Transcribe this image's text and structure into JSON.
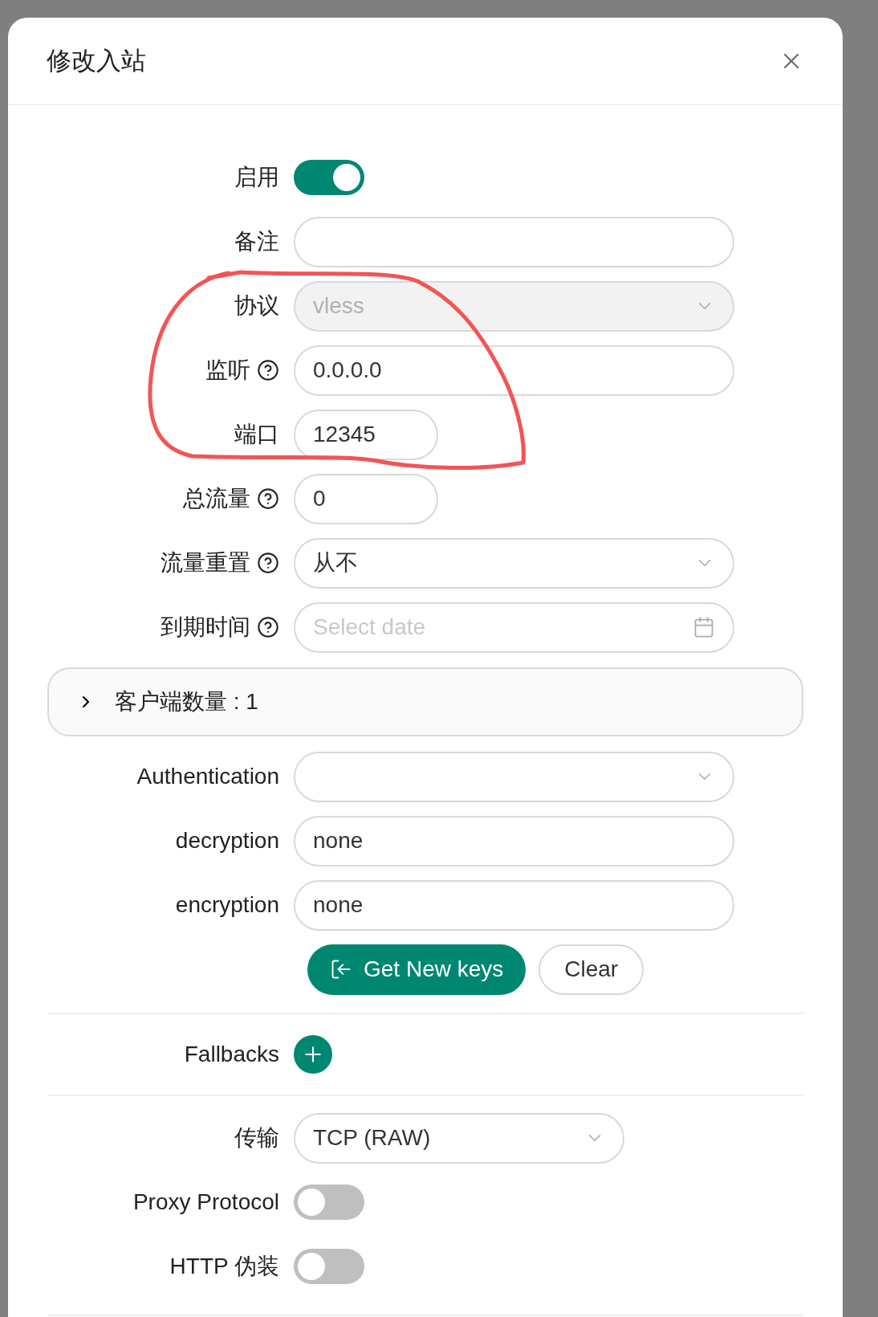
{
  "dialog": {
    "title": "修改入站"
  },
  "fields": [
    {
      "kind": "switch",
      "label": "启用",
      "on": true
    },
    {
      "kind": "input",
      "label": "备注"
    },
    {
      "kind": "select",
      "label": "协议",
      "value": "vless",
      "disabled": true
    },
    {
      "kind": "input",
      "label": "监听",
      "help": true,
      "value": "0.0.0.0"
    },
    {
      "kind": "number",
      "label": "端口",
      "value": "12345"
    },
    {
      "kind": "number",
      "label": "总流量",
      "help": true,
      "value": "0"
    },
    {
      "kind": "select",
      "label": "流量重置",
      "help": true,
      "value": "从不",
      "disabled": false
    },
    {
      "kind": "date",
      "label": "到期时间",
      "help": true,
      "placeholder": "Select date"
    }
  ],
  "clients_panel": {
    "label": "客户端数量 : 1",
    "expanded": false
  },
  "auth_fields": [
    {
      "kind": "select",
      "label": "Authentication"
    },
    {
      "kind": "input",
      "label": "decryption",
      "value": "none"
    },
    {
      "kind": "input",
      "label": "encryption",
      "value": "none"
    }
  ],
  "buttons": [
    {
      "kind": "primary",
      "label": "Get New keys"
    },
    {
      "kind": "default",
      "label": "Clear"
    }
  ],
  "fallbacks": {
    "label": "Fallbacks"
  },
  "transport_fields": [
    {
      "kind": "select",
      "label": "传输",
      "value": "TCP (RAW)",
      "disabled": false
    },
    {
      "kind": "switch",
      "label": "Proxy Protocol",
      "on": false
    },
    {
      "kind": "switch",
      "label": "HTTP 伪装",
      "on": false
    }
  ]
}
